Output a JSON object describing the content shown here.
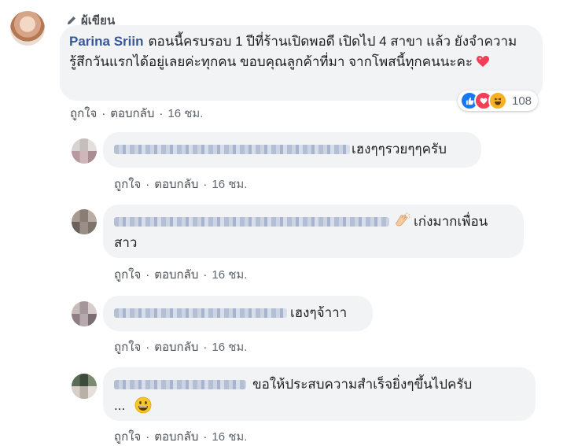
{
  "post": {
    "author_badge": "ผู้เขียน",
    "author": "Parina Sriin",
    "text": "ตอนนี้ครบรอบ 1 ปีที่ร้านเปิดพอดี เปิดไป 4 สาขา แล้ว ยังจำความรู้สึกวันแรกได้อยู่เลยค่ะทุกคน ขอบคุณลูกค้าที่มา จากโพสนี้ทุกคนนะคะ",
    "reaction_count": "108",
    "reactions": [
      "like",
      "love",
      "haha"
    ],
    "like_label": "ถูกใจ",
    "reply_label": "ตอบกลับ",
    "time": "16 ชม."
  },
  "replies": [
    {
      "text": "เฮงๆๆรวยๆๆครับ",
      "like_label": "ถูกใจ",
      "reply_label": "ตอบกลับ",
      "time": "16 ชม."
    },
    {
      "text_line1": "เก่งมากเพื่อน",
      "text_line2": "สาว",
      "like_label": "ถูกใจ",
      "reply_label": "ตอบกลับ",
      "time": "16 ชม."
    },
    {
      "text": "เฮงๆจ้าาา",
      "like_label": "ถูกใจ",
      "reply_label": "ตอบกลับ",
      "time": "16 ชม."
    },
    {
      "text_line1": "ขอให้ประสบความสำเร็จยิ่งๆขึ้นไปครับ",
      "text_line2": "...",
      "like_label": "ถูกใจ",
      "reply_label": "ตอบกลับ",
      "time": "16 ชม."
    }
  ],
  "colors": {
    "author_name": "#385898",
    "bubble": "#f2f3f5",
    "heart": "#f33e58",
    "like": "#1877f2"
  }
}
